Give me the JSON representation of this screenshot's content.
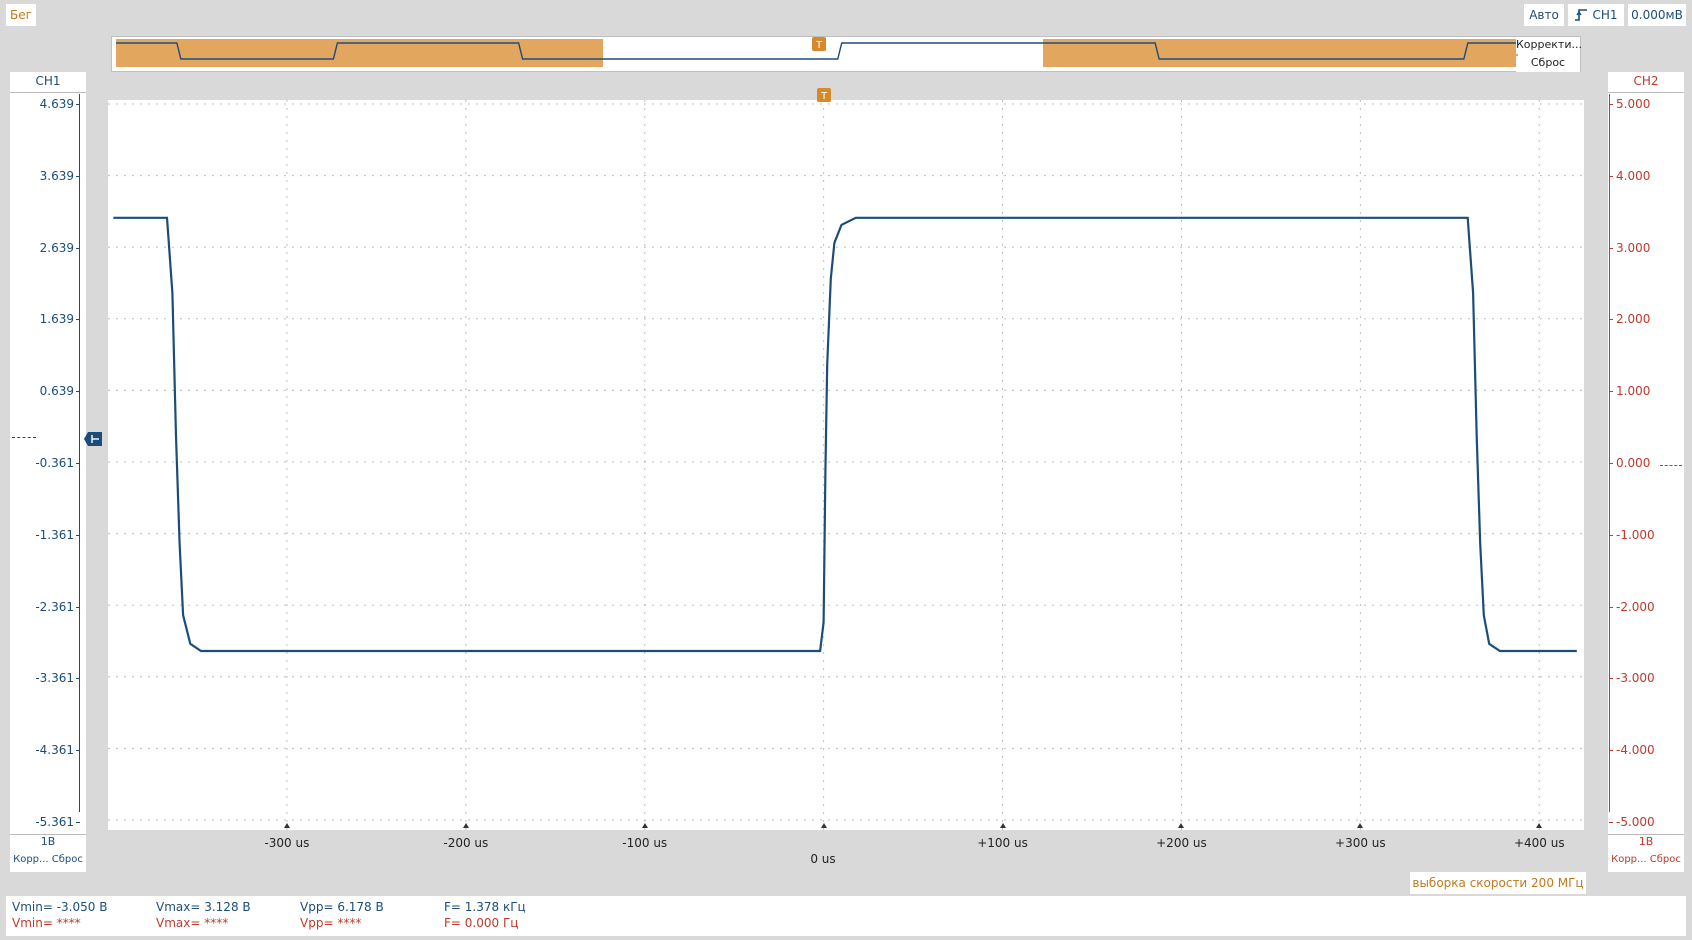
{
  "toolbar": {
    "run_label": "Бег",
    "mode_label": "Авто",
    "trigger_source": "CH1",
    "trigger_level": "0.000мВ"
  },
  "overview": {
    "corr_label": "Корректи...",
    "reset_label": "Сброс"
  },
  "ch1": {
    "title": "CH1",
    "color": "#1c4d7a",
    "ticks": [
      "4.639",
      "3.639",
      "2.639",
      "1.639",
      "0.639",
      "-0.361",
      "-1.361",
      "-2.361",
      "-3.361",
      "-4.361",
      "-5.361"
    ],
    "scale": "1В",
    "corr": "Корр...",
    "reset": "Сброс"
  },
  "ch2": {
    "title": "CH2",
    "color": "#c0392b",
    "ticks": [
      "5.000",
      "4.000",
      "3.000",
      "2.000",
      "1.000",
      "0.000",
      "-1.000",
      "-2.000",
      "-3.000",
      "-4.000",
      "-5.000"
    ],
    "scale": "1В",
    "corr": "Корр...",
    "reset": "Сброс"
  },
  "timebase": {
    "labels": [
      "-300 us",
      "-200 us",
      "-100 us",
      "+100 us",
      "+200 us",
      "+300 us",
      "+400 us"
    ],
    "center_label": "0 us"
  },
  "sample_rate": "выборка скорости 200 МГц",
  "measurements": {
    "ch1": {
      "vmin": "Vmin= -3.050 В",
      "vmax": "Vmax= 3.128 В",
      "vpp": "Vpp= 6.178 В",
      "freq": "F= 1.378 кГц"
    },
    "ch2": {
      "vmin": "Vmin= ****",
      "vmax": "Vmax= ****",
      "vpp": "Vpp= ****",
      "freq": "F= 0.000 Гц"
    }
  },
  "chart_data": {
    "type": "line",
    "x_unit": "us",
    "y_unit": "V",
    "xlim": [
      -400,
      425
    ],
    "ylim": [
      -5.361,
      4.639
    ],
    "series": [
      {
        "name": "CH1",
        "color": "#1c4d7a",
        "points": [
          [
            -397,
            3.05
          ],
          [
            -367,
            3.05
          ],
          [
            -364,
            2.0
          ],
          [
            -362,
            0.0
          ],
          [
            -360,
            -1.5
          ],
          [
            -358,
            -2.5
          ],
          [
            -354,
            -2.9
          ],
          [
            -348,
            -3.0
          ],
          [
            -2,
            -3.0
          ],
          [
            0,
            -2.6
          ],
          [
            1,
            -0.5
          ],
          [
            2,
            1.0
          ],
          [
            4,
            2.2
          ],
          [
            6,
            2.7
          ],
          [
            10,
            2.95
          ],
          [
            18,
            3.05
          ],
          [
            360,
            3.05
          ],
          [
            363,
            2.0
          ],
          [
            365,
            0.0
          ],
          [
            367,
            -1.5
          ],
          [
            369,
            -2.5
          ],
          [
            372,
            -2.9
          ],
          [
            378,
            -3.0
          ],
          [
            421,
            -3.0
          ]
        ]
      }
    ]
  }
}
